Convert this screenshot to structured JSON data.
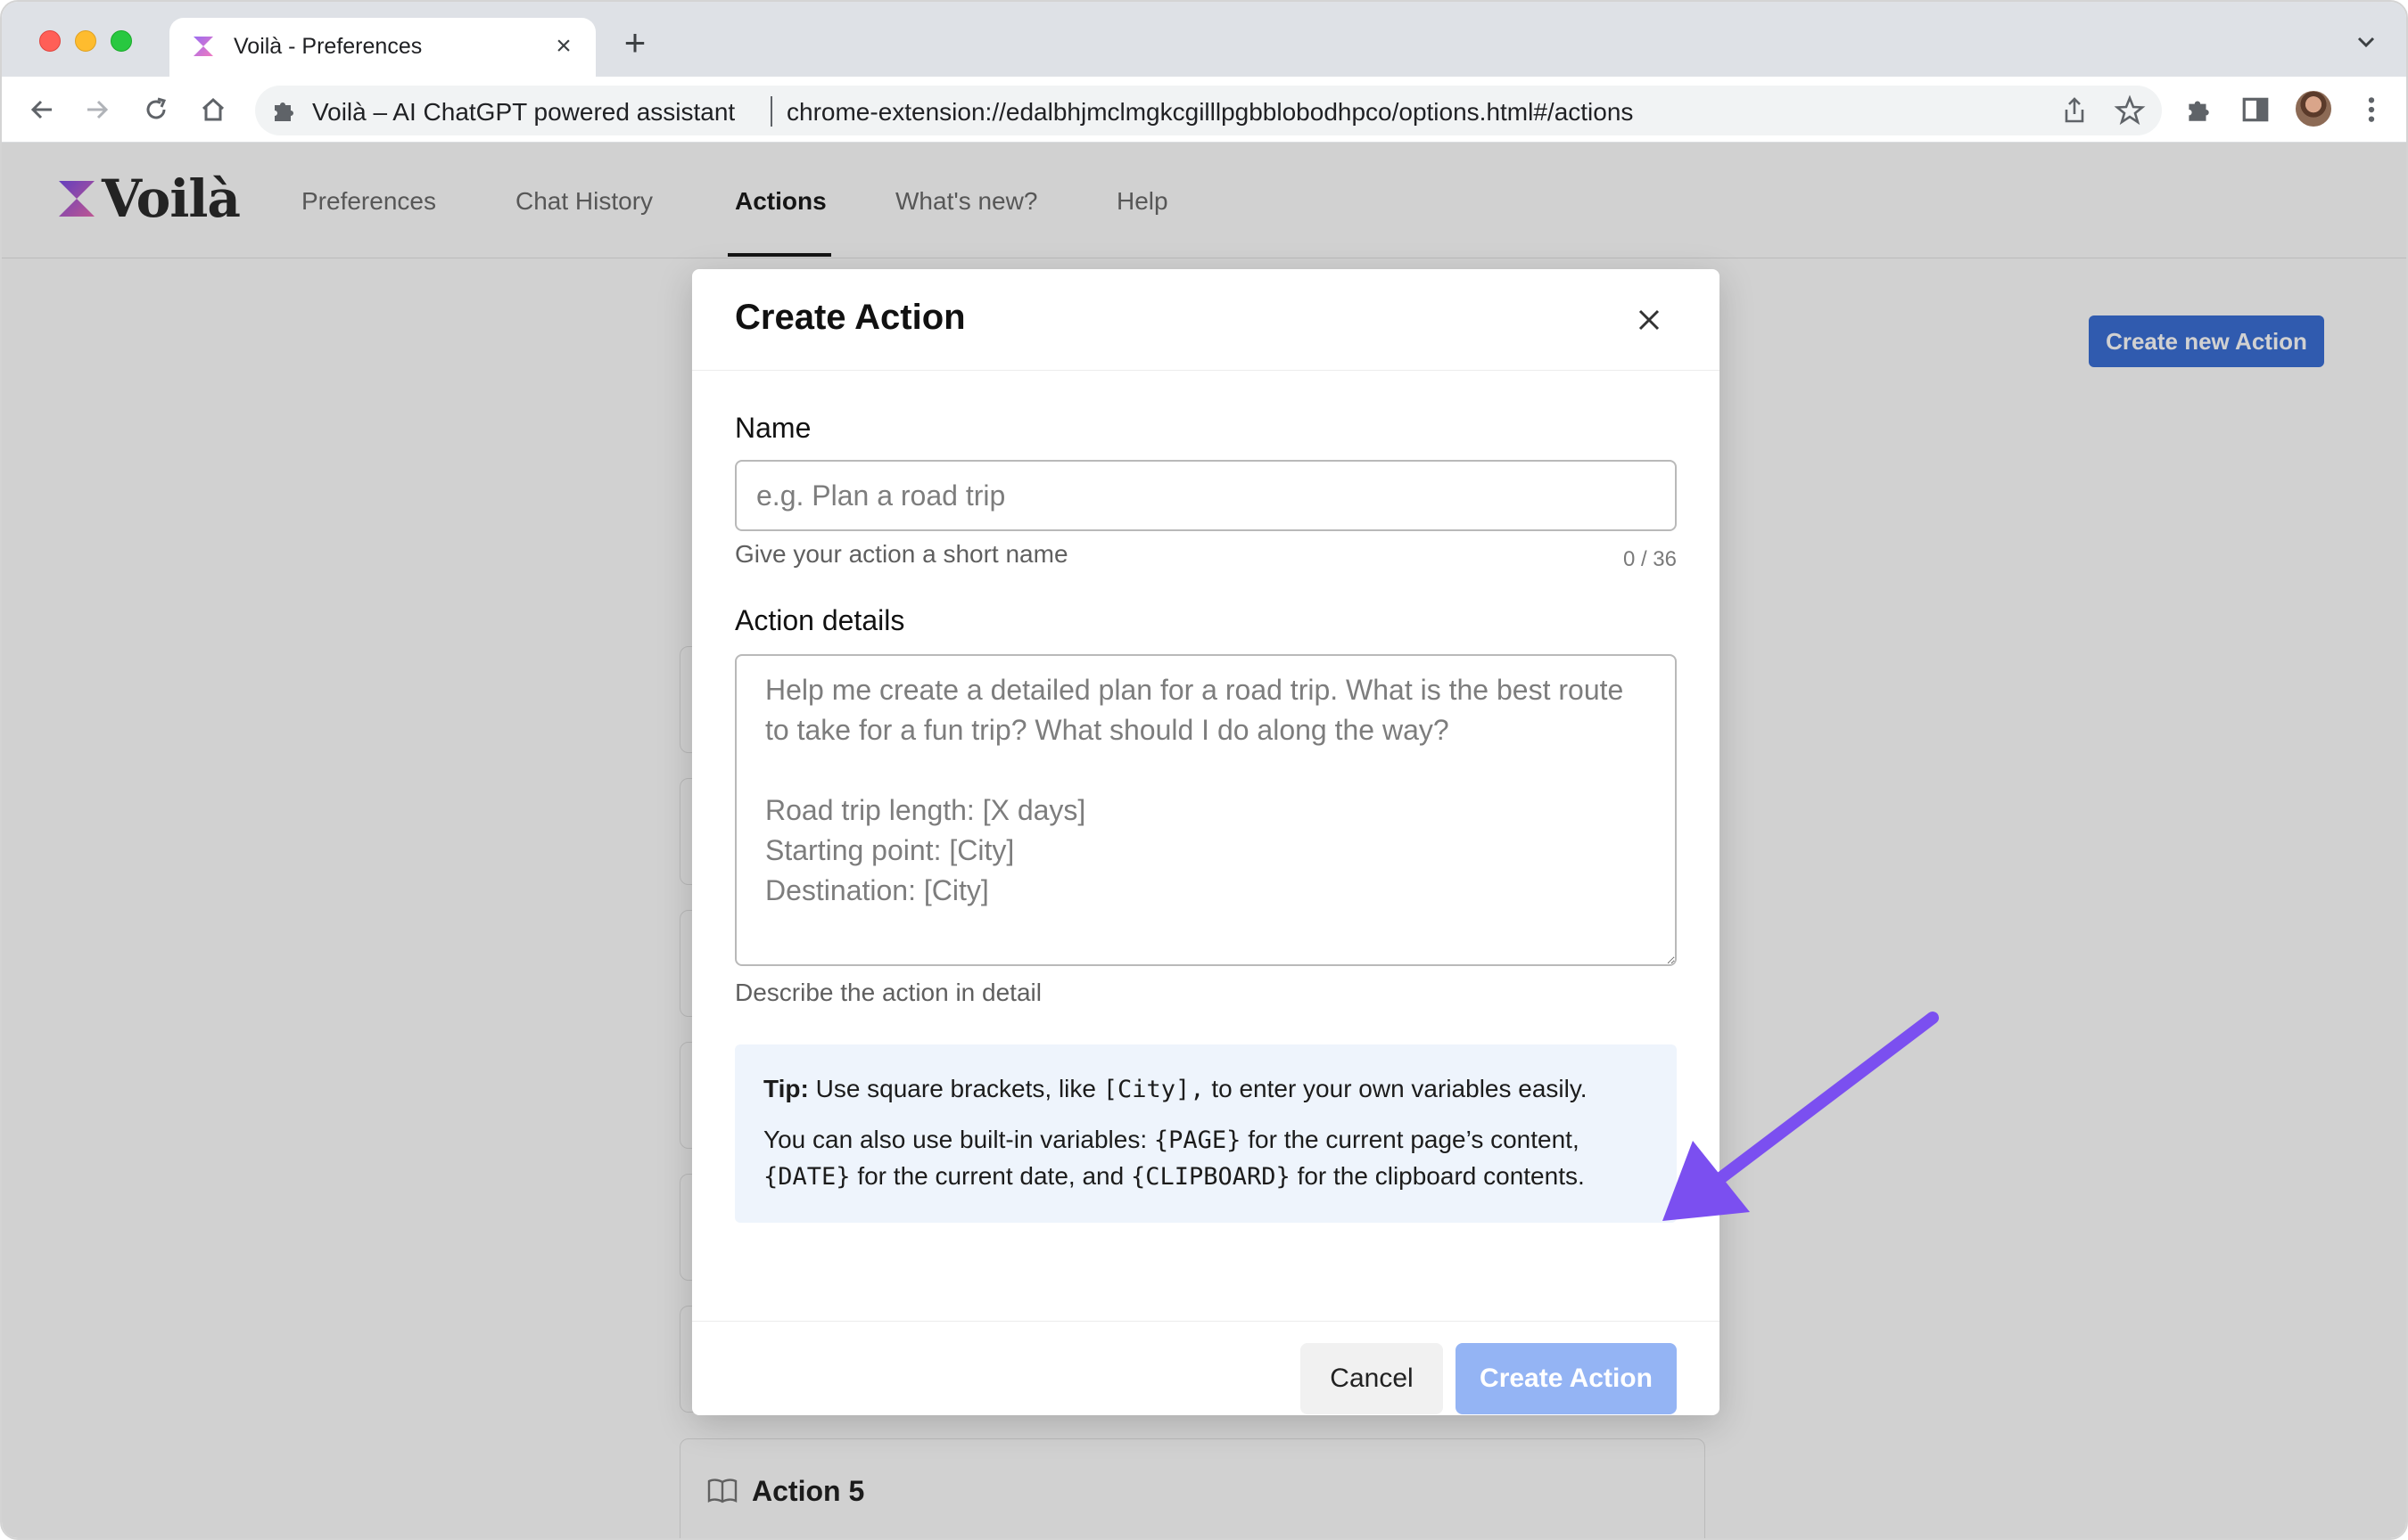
{
  "browser": {
    "tab_title": "Voilà - Preferences",
    "omnibox_title": "Voilà – AI ChatGPT powered assistant",
    "url": "chrome-extension://edalbhjmclmgkcgilllpgbblobodhpco/options.html#/actions"
  },
  "app": {
    "brand": "Voilà",
    "nav": [
      {
        "label": "Preferences"
      },
      {
        "label": "Chat History"
      },
      {
        "label": "Actions"
      },
      {
        "label": "What's new?"
      },
      {
        "label": "Help"
      }
    ],
    "active_nav": "Actions",
    "create_new_label": "Create new Action",
    "bg_card_label": "Action 5"
  },
  "modal": {
    "title": "Create Action",
    "name_label": "Name",
    "name_value": "",
    "name_placeholder": "e.g. Plan a road trip",
    "name_help": "Give your action a short name",
    "name_counter": "0 / 36",
    "details_label": "Action details",
    "details_placeholder": "Help me create a detailed plan for a road trip. What is the best route to take for a fun trip? What should I do along the way?\n\nRoad trip length: [X days]\nStarting point: [City]\nDestination: [City]",
    "details_help": "Describe the action in detail",
    "tip": {
      "label": "Tip:",
      "line1_a": "Use square brackets, like",
      "line1_code": "[City],",
      "line1_b": "to enter your own variables easily.",
      "line2_a": "You can also use built-in variables:",
      "code_page": "{PAGE}",
      "line2_b": "for the current page’s content,",
      "code_date": "{DATE}",
      "line2_c": "for the current date, and",
      "code_clipboard": "{CLIPBOARD}",
      "line2_d": "for the clipboard contents."
    },
    "cancel_label": "Cancel",
    "create_label": "Create Action"
  },
  "colors": {
    "accent": "#3b6fd6",
    "create_disabled": "#94b4f4",
    "tip_bg": "#eef4fc",
    "annotation_arrow": "#7b4ff0"
  }
}
